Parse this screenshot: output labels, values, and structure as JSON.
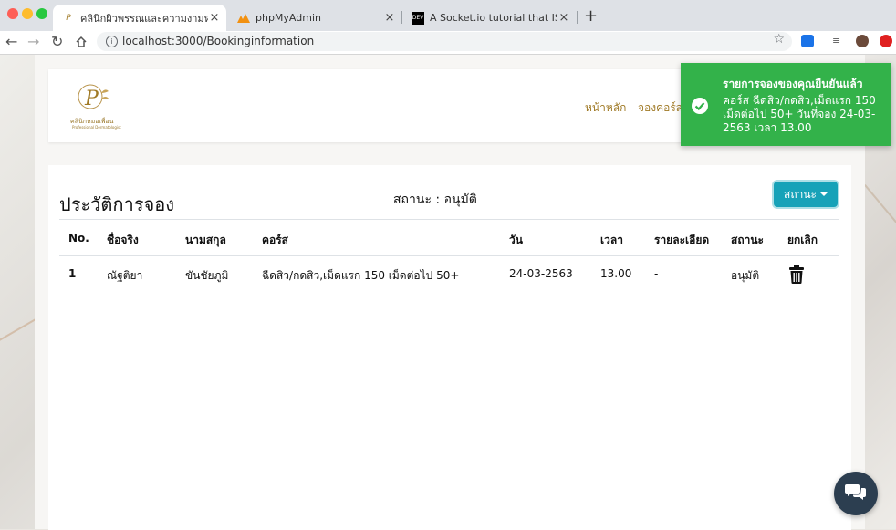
{
  "browser": {
    "tabs": [
      {
        "title": "คลินิกผิวพรรณและความงามหมอเพื่อน",
        "active": true
      },
      {
        "title": "phpMyAdmin",
        "active": false
      },
      {
        "title": "A Socket.io tutorial that ISN'T a",
        "active": false
      }
    ],
    "url": "localhost:3000/Bookinginformation",
    "favicon_third": "DEV"
  },
  "site": {
    "logo_text": "คลินิกหมอเพื่อน",
    "logo_subtext": "Professional Dermatologist",
    "nav": [
      "หน้าหลัก",
      "จองคอร์ส"
    ]
  },
  "history": {
    "title": "ประวัติการจอง",
    "status_label": "สถานะ : อนุมัติ",
    "status_button": "สถานะ",
    "headers": [
      "No.",
      "ชื่อจริง",
      "นามสกุล",
      "คอร์ส",
      "วัน",
      "เวลา",
      "รายละเอียด",
      "สถานะ",
      "ยกเลิก"
    ],
    "rows": [
      {
        "no": "1",
        "first_name": "ณัฐติยา",
        "last_name": "ขันชัยภูมิ",
        "course": "ฉีดสิว/กดสิว,เม็ดแรก 150 เม็ดต่อไป 50+",
        "date": "24-03-2563",
        "time": "13.00",
        "detail": "-",
        "status": "อนุมัติ"
      }
    ]
  },
  "toast": {
    "title": "รายการจองของคุณยืนยันแล้ว",
    "message": "คอร์ส ฉีดสิว/กดสิว,เม็ดแรก 150 เม็ดต่อไป 50+ วันที่จอง 24-03-2563 เวลา 13.00",
    "color": "#33b24a"
  },
  "colors": {
    "accent": "#17a2b8",
    "gold": "#a07a26"
  }
}
